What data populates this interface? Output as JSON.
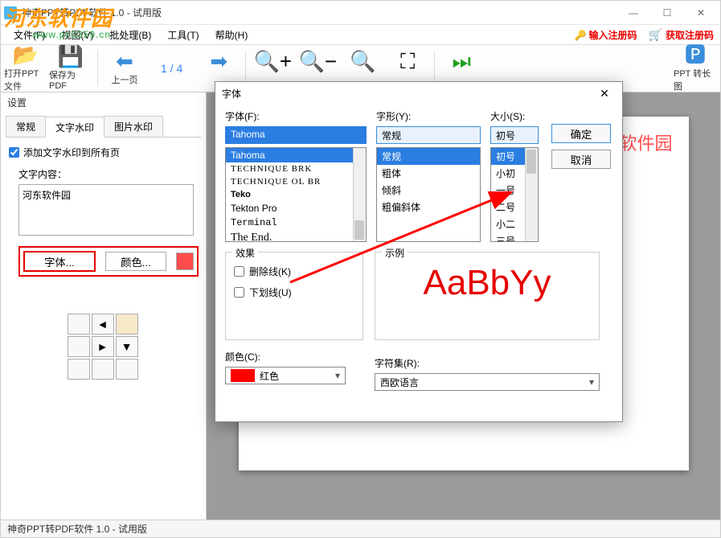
{
  "window": {
    "title": "神奇PPT转PDF软件 1.0 - 试用版",
    "reg_code": "输入注册码",
    "get_code": "获取注册码"
  },
  "menu": {
    "file": "文件(F)",
    "view": "视图(V)",
    "batch": "批处理(B)",
    "tools": "工具(T)",
    "help": "帮助(H)"
  },
  "watermark_logo": {
    "text": "河东软件园",
    "url": "www.pc0359.cn"
  },
  "toolbar": {
    "open": "打开PPT文件",
    "save": "保存为PDF",
    "prev": "上一页",
    "page": "1 / 4",
    "next": "下一页",
    "zoom_in": "放大",
    "zoom_out": "缩小",
    "fit": "适合尺寸",
    "fullscreen": "适合宽度",
    "batch": "批量转换",
    "long": "PPT 转长图"
  },
  "side": {
    "title": "设置",
    "tabs": {
      "general": "常规",
      "text_wm": "文字水印",
      "img_wm": "图片水印"
    },
    "add_text_wm": "添加文字水印到所有页",
    "content_label": "文字内容：",
    "content_value": "河东软件园",
    "font_btn": "字体...",
    "color_btn": "颜色..."
  },
  "preview": {
    "watermark": "东软件园"
  },
  "dialog": {
    "title": "字体",
    "close": "✕",
    "font_label": "字体(F):",
    "font_value": "Tahoma",
    "font_list": [
      "Tahoma",
      "TECHNIQUE BRK",
      "TECHNIQUE OL BR",
      "Teko",
      "Tekton Pro",
      "Terminal",
      "The End."
    ],
    "style_label": "字形(Y):",
    "style_value": "常规",
    "style_list": [
      "常规",
      "粗体",
      "倾斜",
      "粗偏斜体"
    ],
    "size_label": "大小(S):",
    "size_value": "初号",
    "size_list": [
      "初号",
      "小初",
      "一号",
      "二号",
      "小二",
      "三号"
    ],
    "ok": "确定",
    "cancel": "取消",
    "effect_title": "效果",
    "strike": "删除线(K)",
    "underline": "下划线(U)",
    "color_label": "颜色(C):",
    "color_name": "红色",
    "sample_title": "示例",
    "sample_text": "AaBbYy",
    "charset_label": "字符集(R):",
    "charset_value": "西欧语言"
  },
  "statusbar": "神奇PPT转PDF软件 1.0 - 试用版"
}
